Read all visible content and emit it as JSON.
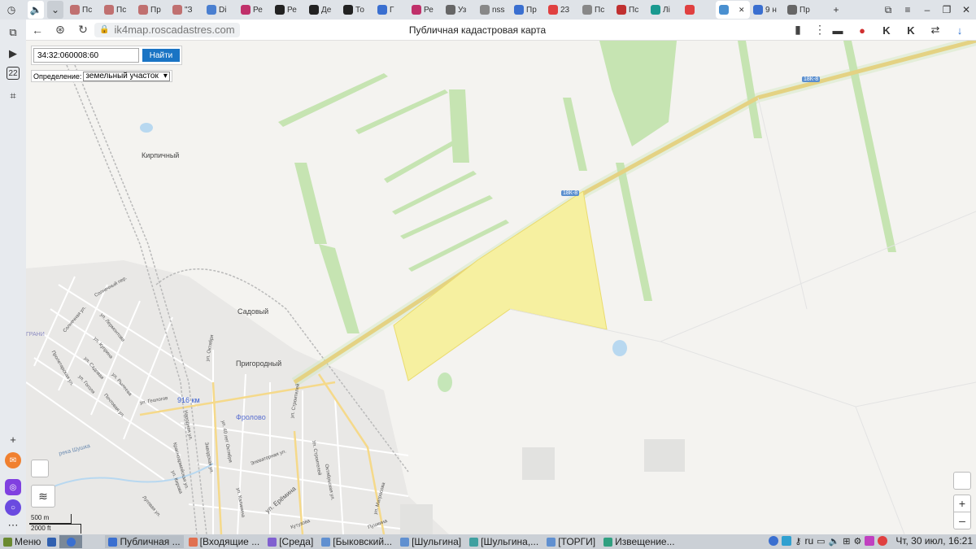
{
  "tabs": [
    {
      "label": "Пс",
      "color": "#c07070"
    },
    {
      "label": "Пс",
      "color": "#c07070"
    },
    {
      "label": "Пр",
      "color": "#c07070"
    },
    {
      "label": "\"З",
      "color": "#c07070"
    },
    {
      "label": "Di",
      "color": "#4a7fd0"
    },
    {
      "label": "Ре",
      "color": "#c0306a"
    },
    {
      "label": "Ре",
      "color": "#222222"
    },
    {
      "label": "Де",
      "color": "#222222"
    },
    {
      "label": "То",
      "color": "#222222"
    },
    {
      "label": "Г",
      "color": "#3a6fd0"
    },
    {
      "label": "Ре",
      "color": "#c0306a"
    },
    {
      "label": "Уз",
      "color": "#666666"
    },
    {
      "label": "nss",
      "color": "#888888"
    },
    {
      "label": "Пр",
      "color": "#3a6fd0"
    },
    {
      "label": "23",
      "color": "#e04040"
    },
    {
      "label": "Пс",
      "color": "#888888"
    },
    {
      "label": "Пс",
      "color": "#c03030"
    },
    {
      "label": "Лі",
      "color": "#1a9a90"
    },
    {
      "label": "",
      "color": "#e04040"
    },
    {
      "label": "",
      "color": "#4a90d0",
      "active": true
    },
    {
      "label": "9 н",
      "color": "#3a6fd0"
    },
    {
      "label": "Пр",
      "color": "#666666"
    }
  ],
  "address": {
    "url": "ik4map.roscadastres.com",
    "page_title": "Публичная кадастровая карта"
  },
  "side_panel": {
    "calendar_day": "22"
  },
  "search": {
    "cadastral_number": "34:32:060008:60",
    "find_button": "Найти",
    "definition_label": "Определение:",
    "definition_value": "земельный участок"
  },
  "map_labels": {
    "kirpichny": "Кирпичный",
    "sadovy": "Садовый",
    "prigorodny": "Пригородный",
    "frolovo": "Фролово",
    "km916": "916 км",
    "road1": "18К-8",
    "road2": "18К-8",
    "graniza": "ГРАНИ",
    "streets": [
      "Солнечный пер.",
      "Солнечная ул.",
      "ул. Лермонтова",
      "ул. Куприна",
      "ул. Садовая",
      "ул. Гоголя",
      "ул. Рылеева",
      "Почтовая ул.",
      "ул. Геологов",
      "Пролетарская ул.",
      "ул. Октября",
      "ул. 40 лет Октября",
      "ул. Строителей",
      "Красноармейская ул.",
      "Заводская ул.",
      "Народная ул.",
      "ул. Кирова",
      "Луговая ул.",
      "ул. Ерёмина",
      "ул. Калинина",
      "Элеваторная ул.",
      "Октябрьская ул.",
      "ул. Матросова",
      "Ул. Строителей",
      "Кутузова",
      "Пушкина"
    ],
    "river": "река Шушка"
  },
  "scale": {
    "metric": "500 m",
    "imperial": "2000 ft"
  },
  "taskbar": {
    "menu": "Меню",
    "tasks": [
      {
        "label": "Публичная ...",
        "color": "#3a6fd0",
        "active": true
      },
      {
        "label": "[Входящие ...",
        "color": "#e07050"
      },
      {
        "label": "[Среда]",
        "color": "#8060d0"
      },
      {
        "label": "[Быковский...",
        "color": "#6090d0"
      },
      {
        "label": "[Шульгина]",
        "color": "#6090d0"
      },
      {
        "label": "[Шульгина,...",
        "color": "#40a0a0"
      },
      {
        "label": "[ТОРГИ]",
        "color": "#6090d0"
      },
      {
        "label": "Извещение...",
        "color": "#30a080"
      }
    ],
    "lang": "ru",
    "datetime": "Чт, 30 июл, 16:21"
  },
  "colors": {
    "parcel_fill": "#f6f0a0",
    "field_green": "#c6e4b2",
    "road_orange": "#f5c86a",
    "find_blue": "#1a74c4"
  }
}
